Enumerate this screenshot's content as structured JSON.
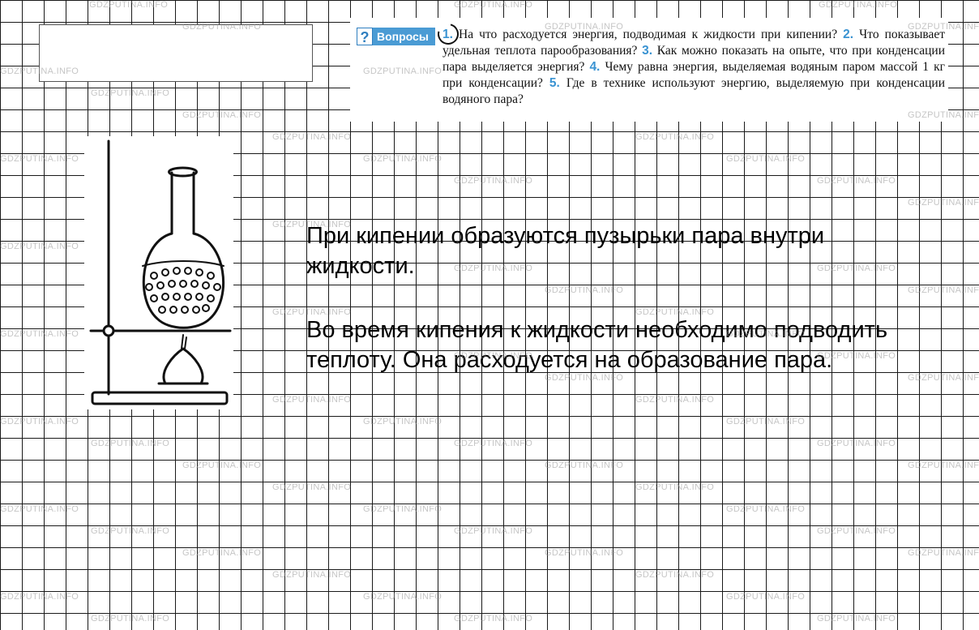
{
  "questions": {
    "badge_label": "Вопросы",
    "items": [
      {
        "num": "1.",
        "text": "На что расходуется энергия, подводимая к жидкости при кипении?"
      },
      {
        "num": "2.",
        "text": "Что показывает удельная теплота парообразования?"
      },
      {
        "num": "3.",
        "text": "Как можно показать на опыте, что при конденсации пара выделяется энергия?"
      },
      {
        "num": "4.",
        "text": "Чему равна энергия, выделяемая водяным паром массой 1 кг при конденсации?"
      },
      {
        "num": "5.",
        "text": "Где в технике используют энергию, выделяемую при конденсации водяного пара?"
      }
    ]
  },
  "answer": {
    "paragraph1": "При кипении образуются пузырьки пара внутри жидкости.",
    "paragraph2": "Во время кипения к жидкости необходимо подводить теплоту. Она расходуется на образование пара."
  },
  "watermark": {
    "text": "GDZPUTINA.INFO"
  },
  "colors": {
    "grid_line": "#1a1a1a",
    "badge_bg": "#4a9bd4",
    "question_number": "#3a93d2"
  }
}
